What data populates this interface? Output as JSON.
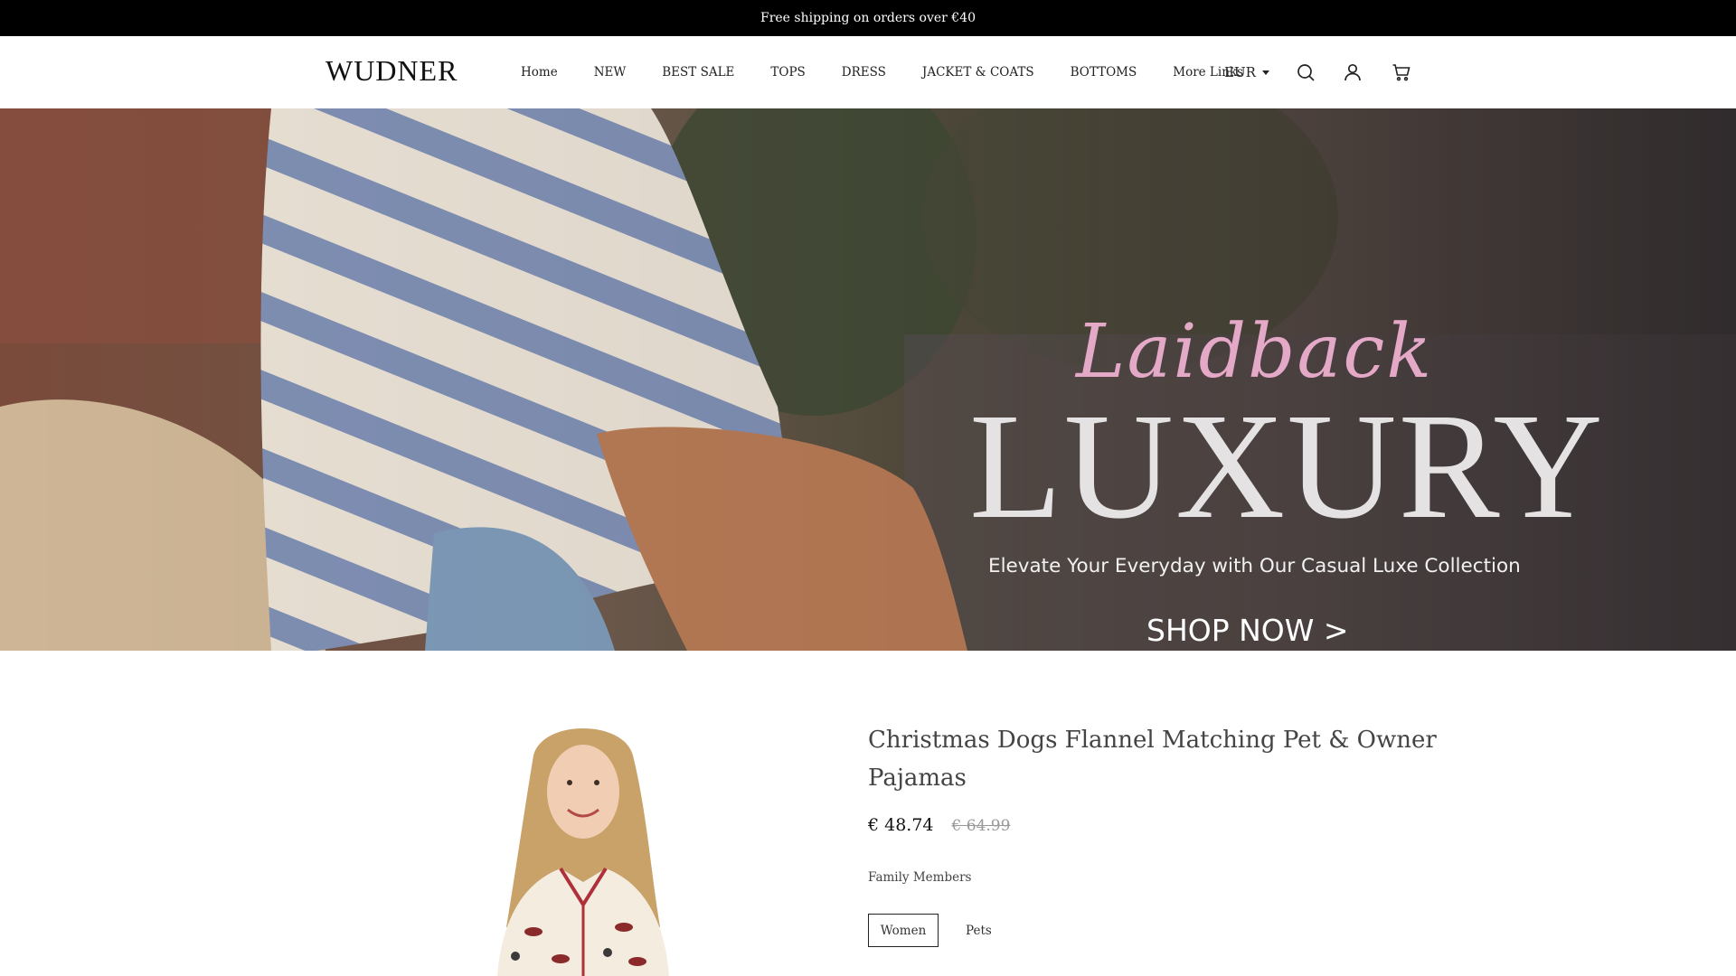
{
  "announcement": {
    "text": "Free shipping on orders over €40"
  },
  "header": {
    "logo": "WUDNER",
    "nav": [
      {
        "label": "Home"
      },
      {
        "label": "NEW"
      },
      {
        "label": "BEST SALE"
      },
      {
        "label": "TOPS"
      },
      {
        "label": "DRESS"
      },
      {
        "label": "JACKET & COATS"
      },
      {
        "label": "BOTTOMS"
      },
      {
        "label": "More Links"
      }
    ],
    "currency": "EUR",
    "icons": [
      "search-icon",
      "account-icon",
      "cart-icon"
    ]
  },
  "hero": {
    "script_text": "Laidback",
    "headline": "LUXURY",
    "subtitle": "Elevate Your Everyday with Our Casual Luxe Collection",
    "cta": "SHOP NOW >",
    "colors": {
      "script": "#e5a9c8",
      "headline": "#e4e2e2"
    }
  },
  "product": {
    "title": "Christmas Dogs Flannel Matching Pet & Owner Pajamas",
    "price": "€ 48.74",
    "compare_price": "€ 64.99",
    "option_label": "Family Members",
    "options": [
      {
        "label": "Women",
        "selected": true
      },
      {
        "label": "Pets",
        "selected": false
      }
    ]
  }
}
